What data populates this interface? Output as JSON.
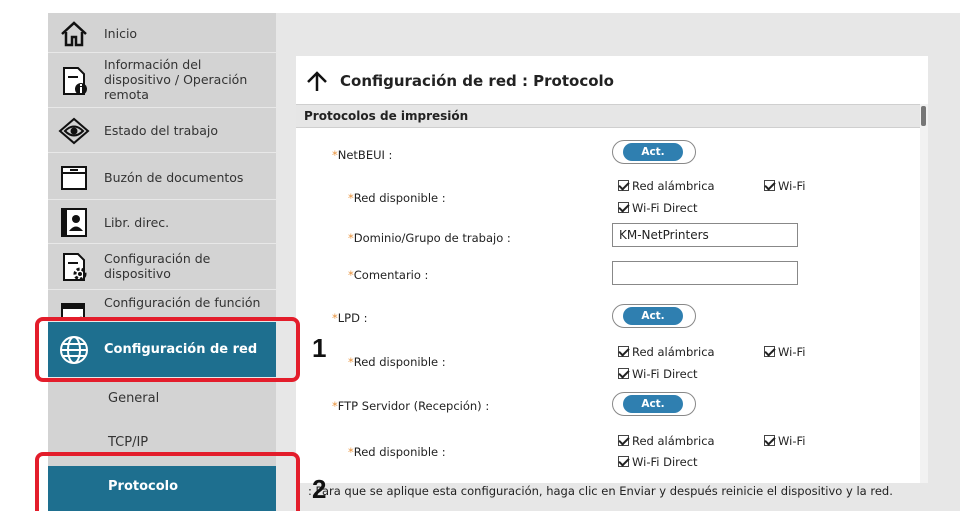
{
  "sidebar": {
    "items": [
      {
        "label": "Inicio",
        "icon": "home-icon"
      },
      {
        "label": "Información del dispositivo / Operación remota",
        "icon": "device-info-icon"
      },
      {
        "label": "Estado del trabajo",
        "icon": "eye-icon"
      },
      {
        "label": "Buzón de documentos",
        "icon": "folder-icon"
      },
      {
        "label": "Libr. direc.",
        "icon": "address-book-icon"
      },
      {
        "label": "Configuración de dispositivo",
        "icon": "device-settings-icon"
      },
      {
        "label": "Configuración de función",
        "icon": "function-settings-icon"
      },
      {
        "label": "Configuración de red",
        "icon": "globe-icon"
      }
    ],
    "sub_items": [
      {
        "label": "General"
      },
      {
        "label": "TCP/IP"
      },
      {
        "label": "Protocolo"
      }
    ],
    "active_color": "#1e6f8f"
  },
  "page": {
    "title": "Configuración de red : Protocolo",
    "section": "Protocolos de impresión"
  },
  "settings": {
    "netbeui": {
      "label": "NetBEUI :",
      "toggle": "Act."
    },
    "netbeui_available": {
      "label": "Red disponible :",
      "wired": "Red alámbrica",
      "wifi": "Wi-Fi",
      "wifi_direct": "Wi-Fi Direct"
    },
    "workgroup": {
      "label": "Dominio/Grupo de trabajo :",
      "value": "KM-NetPrinters"
    },
    "comment": {
      "label": "Comentario :",
      "value": ""
    },
    "lpd": {
      "label": "LPD :",
      "toggle": "Act."
    },
    "lpd_available": {
      "label": "Red disponible :",
      "wired": "Red alámbrica",
      "wifi": "Wi-Fi",
      "wifi_direct": "Wi-Fi Direct"
    },
    "ftp": {
      "label": "FTP Servidor (Recepción) :",
      "toggle": "Act."
    },
    "ftp_available": {
      "label": "Red disponible :",
      "wired": "Red alámbrica",
      "wifi": "Wi-Fi",
      "wifi_direct": "Wi-Fi Direct"
    },
    "required_mark": "*"
  },
  "footnote": ": Para que se aplique esta configuración, haga clic en Enviar y después reinicie el dispositivo y la red.",
  "callouts": {
    "one": "1",
    "two": "2",
    "color": "#e31d2b"
  }
}
